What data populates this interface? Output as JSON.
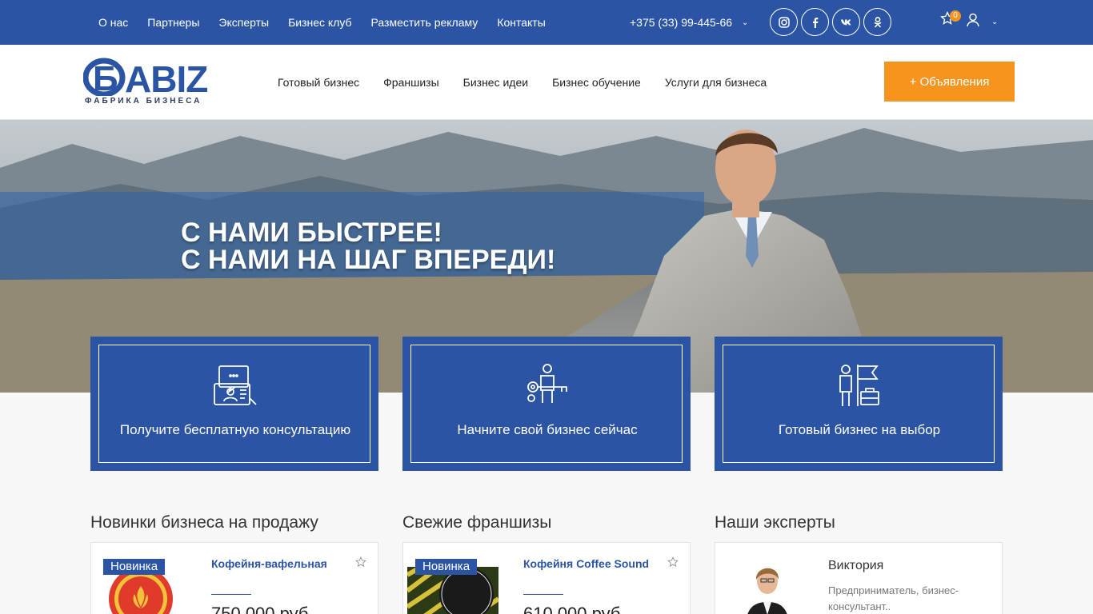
{
  "topbar": {
    "nav": [
      "О нас",
      "Партнеры",
      "Эксперты",
      "Бизнес клуб",
      "Разместить рекламу",
      "Контакты"
    ],
    "phone": "+375 (33) 99-445-66",
    "socials": [
      "instagram-icon",
      "facebook-icon",
      "vk-icon",
      "odnoklassniki-icon"
    ],
    "favorites_count": "0"
  },
  "header": {
    "logo_text": "БABIZ",
    "logo_subtitle": "ФАБРИКА БИЗНЕСА",
    "nav": [
      "Готовый бизнес",
      "Франшизы",
      "Бизнес идеи",
      "Бизнес обучение",
      "Услуги для бизнеса"
    ],
    "ads_button": "+ Объявления"
  },
  "hero": {
    "line1": "С НАМИ БЫСТРЕЕ!",
    "line2": "С НАМИ НА ШАГ ВПЕРЕДИ!"
  },
  "cards": [
    {
      "label": "Получите бесплатную консультацию",
      "icon": "consultation-icon"
    },
    {
      "label": "Начните свой бизнес сейчас",
      "icon": "start-business-icon"
    },
    {
      "label": "Готовый бизнес на выбор",
      "icon": "ready-business-icon"
    }
  ],
  "sections": {
    "business": {
      "title": "Новинки бизнеса на продажу",
      "badge": "Новинка",
      "item_title": "Кофейня-вафельная",
      "price": "750 000 руб"
    },
    "franchises": {
      "title": "Свежие франшизы",
      "badge": "Новинка",
      "item_title": "Кофейня Coffee Sound",
      "price": "610 000 руб"
    },
    "experts": {
      "title": "Наши эксперты",
      "name": "Виктория",
      "desc": "Предприниматель, бизнес-консультант.."
    }
  },
  "colors": {
    "brand_blue": "#2b55a4",
    "accent_orange": "#f7941d"
  }
}
